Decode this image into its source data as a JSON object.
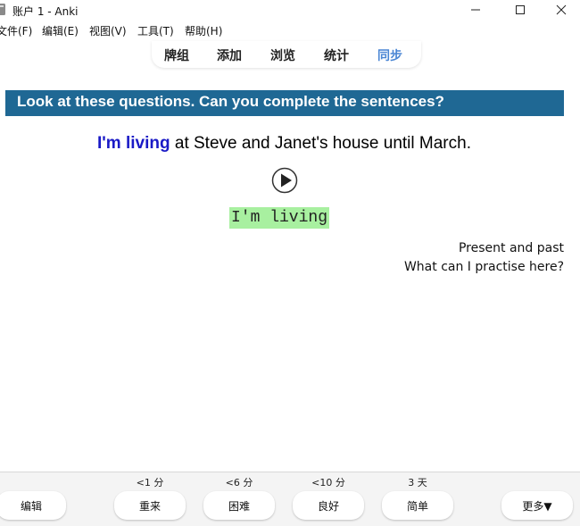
{
  "window": {
    "title": "账户 1 - Anki"
  },
  "menubar": {
    "file": "文件(F)",
    "edit": "编辑(E)",
    "view": "视图(V)",
    "tools": "工具(T)",
    "help": "帮助(H)"
  },
  "toolbar": {
    "decks": "牌组",
    "add": "添加",
    "browse": "浏览",
    "stats": "统计",
    "sync": "同步"
  },
  "card": {
    "banner": "Look at these questions. Can you complete the sentences?",
    "sentence_highlight": "I'm living",
    "sentence_rest": " at Steve and Janet's house until March.",
    "answer": "I'm living",
    "tag_line1": "Present and past",
    "tag_line2": "What can I practise here?"
  },
  "bottom": {
    "edit_label": "编辑",
    "intervals": {
      "again": "<1 分",
      "hard": "<6 分",
      "good": "<10 分",
      "easy": "3 天"
    },
    "again_label": "重来",
    "hard_label": "困难",
    "good_label": "良好",
    "easy_label": "简单",
    "more_label": "更多▼"
  },
  "colors": {
    "banner_bg": "#1f6894",
    "highlight_text": "#1a1ac6",
    "answer_bg": "#a8f0a0",
    "sync_accent": "#4a86d4"
  }
}
